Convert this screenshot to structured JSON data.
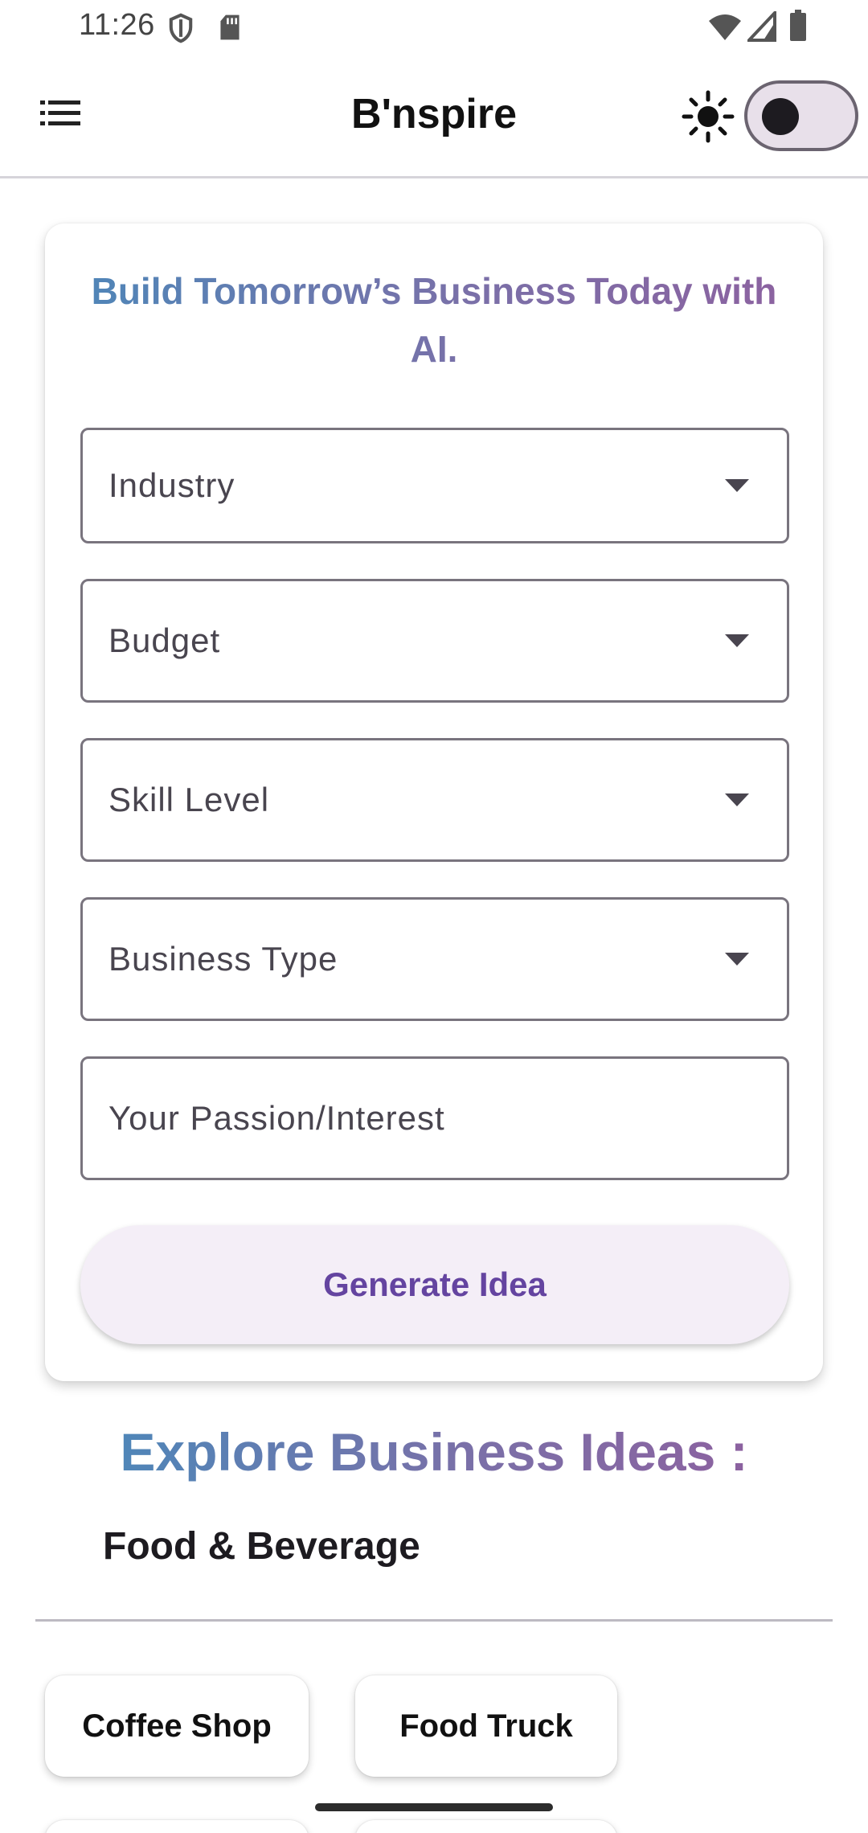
{
  "status_bar": {
    "time": "11:26",
    "icons": [
      "shield-icon",
      "sd-card-icon",
      "wifi-icon",
      "signal-icon",
      "battery-icon"
    ]
  },
  "app_bar": {
    "title": "B'nspire",
    "menu_icon": "menu-list-icon",
    "theme_icon": "sun-icon",
    "theme_toggle_on": false
  },
  "form": {
    "headline": "Build Tomorrow’s Business Today with AI.",
    "fields": [
      {
        "label": "Industry",
        "type": "dropdown"
      },
      {
        "label": "Budget",
        "type": "dropdown"
      },
      {
        "label": "Skill Level",
        "type": "dropdown"
      },
      {
        "label": "Business Type",
        "type": "dropdown"
      },
      {
        "label": "Your Passion/Interest",
        "type": "text"
      }
    ],
    "generate_label": "Generate Idea"
  },
  "explore": {
    "title": "Explore Business Ideas :",
    "category": "Food & Beverage",
    "chips": [
      "Coffee Shop",
      "Food Truck"
    ]
  },
  "colors": {
    "gradient_start": "#4f86b8",
    "gradient_end": "#8c62a0",
    "button_text": "#6444a0",
    "button_bg": "#f4eef7"
  }
}
